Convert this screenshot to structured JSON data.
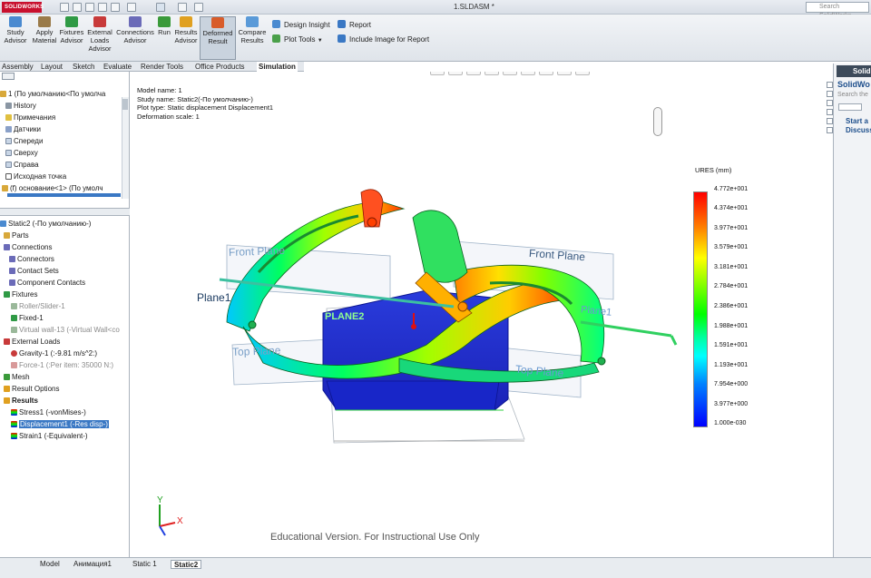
{
  "titlebar": {
    "logo": "SOLIDWORKS",
    "doc_title": "1.SLDASM *",
    "search_placeholder": "Search SolidWorks"
  },
  "ribbon": {
    "buttons": [
      {
        "label": "Study\nAdvisor"
      },
      {
        "label": "Apply\nMaterial"
      },
      {
        "label": "Fixtures\nAdvisor"
      },
      {
        "label": "External\nLoads\nAdvisor"
      },
      {
        "label": "Connections\nAdvisor"
      },
      {
        "label": "Run"
      },
      {
        "label": "Results\nAdvisor"
      },
      {
        "label": "Deformed\nResult"
      },
      {
        "label": "Compare\nResults"
      }
    ],
    "design_insight": "Design Insight",
    "plot_tools": "Plot Tools",
    "report": "Report",
    "include_image": "Include Image for Report"
  },
  "command_tabs": [
    "Assembly",
    "Layout",
    "Sketch",
    "Evaluate",
    "Render Tools",
    "Office Products",
    "Simulation"
  ],
  "feature_tree": {
    "top": [
      {
        "text": "1  (По умолчанию<По умолча"
      },
      {
        "text": "History"
      },
      {
        "text": "Примечания"
      },
      {
        "text": "Датчики"
      },
      {
        "text": "Спереди"
      },
      {
        "text": "Сверху"
      },
      {
        "text": "Справа"
      },
      {
        "text": "Исходная точка"
      },
      {
        "text": "(f) основание<1> (По умолч"
      }
    ],
    "study": [
      {
        "text": "Static2 (-По умолчанию-)"
      },
      {
        "text": "Parts"
      },
      {
        "text": "Connections"
      },
      {
        "text": "Connectors"
      },
      {
        "text": "Contact Sets"
      },
      {
        "text": "Component Contacts"
      },
      {
        "text": "Fixtures"
      },
      {
        "text": "Roller/Slider-1"
      },
      {
        "text": "Fixed-1"
      },
      {
        "text": "Virtual wall-13 (-Virtual Wall<co"
      },
      {
        "text": "External Loads"
      },
      {
        "text": "Gravity-1 (:-9.81 m/s^2:)"
      },
      {
        "text": "Force-1 (:Per item: 35000 N:)"
      },
      {
        "text": "Mesh"
      },
      {
        "text": "Result Options"
      },
      {
        "text": "Results"
      },
      {
        "text": "Stress1 (-vonMises-)"
      },
      {
        "text": "Displacement1 (-Res disp-)"
      },
      {
        "text": "Strain1 (-Equivalent-)"
      }
    ]
  },
  "viewport": {
    "info": [
      "Model name: 1",
      "Study name: Static2(-По умолчанию-)",
      "Plot type: Static displacement Displacement1",
      "Deformation scale: 1"
    ],
    "plane_labels": [
      "Front Plane",
      "Front Plane",
      "Plane1",
      "Plane1",
      "PLANE2",
      "Top Plane",
      "Top Plane"
    ],
    "watermark": "Educational Version. For Instructional Use Only",
    "triad": {
      "y": "Y",
      "x": "X"
    }
  },
  "legend": {
    "title": "URES (mm)",
    "values": [
      "4.772e+001",
      "4.374e+001",
      "3.977e+001",
      "3.579e+001",
      "3.181e+001",
      "2.784e+001",
      "2.386e+001",
      "1.988e+001",
      "1.591e+001",
      "1.193e+001",
      "7.954e+000",
      "3.977e+000",
      "1.000e-030"
    ]
  },
  "bottom_tabs": [
    "Model",
    "Анимация1",
    "Static 1",
    "Static2"
  ],
  "right_panel": {
    "header": "Solid",
    "brand": "SolidWo",
    "search": "Search the",
    "start": "Start a\nDiscuss"
  },
  "colors": {
    "accent": "#3a78c4",
    "brand": "#c8102e",
    "ribbon": "#e4e8ed"
  }
}
